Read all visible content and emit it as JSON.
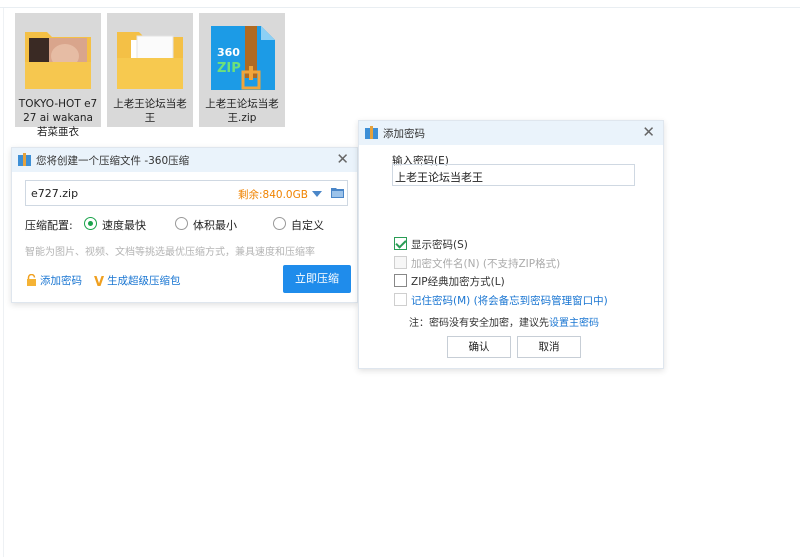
{
  "files": [
    {
      "name": "TOKYO-HOT e727 ai wakana 若菜亜衣",
      "icon": "folder-with-photo-icon"
    },
    {
      "name": "上老王论坛当老王",
      "icon": "folder-with-documents-icon"
    },
    {
      "name": "上老王论坛当老王.zip",
      "icon": "360zip-archive-icon"
    }
  ],
  "compress_dialog": {
    "title": "您将创建一个压缩文件 -360压缩",
    "filename": "e727.zip",
    "free_space": "剩余:840.0GB",
    "config_label": "压缩配置:",
    "options": [
      "速度最快",
      "体积最小",
      "自定义"
    ],
    "selected_option": "速度最快",
    "hint": "智能为图片、视频、文档等挑选最优压缩方式，兼具速度和压缩率",
    "add_password": "添加密码",
    "super_pack": "生成超级压缩包",
    "compress_now": "立即压缩"
  },
  "password_dialog": {
    "title": "添加密码",
    "input_label": "输入密码(E)",
    "password_value": "上老王论坛当老王",
    "show_password": "显示密码(S)",
    "encrypt_filename": "加密文件名(N) (不支持ZIP格式)",
    "zip_classic": "ZIP经典加密方式(L)",
    "remember_password": "记住密码(M) (将会备忘到密码管理窗口中)",
    "note_prefix": "注：密码没有安全加密，建议先",
    "note_link": "设置主密码",
    "ok": "确认",
    "cancel": "取消"
  },
  "colors": {
    "accent": "#1f8ceb",
    "warning": "#f08300",
    "check": "#2a9d55",
    "link": "#1a76d2"
  }
}
